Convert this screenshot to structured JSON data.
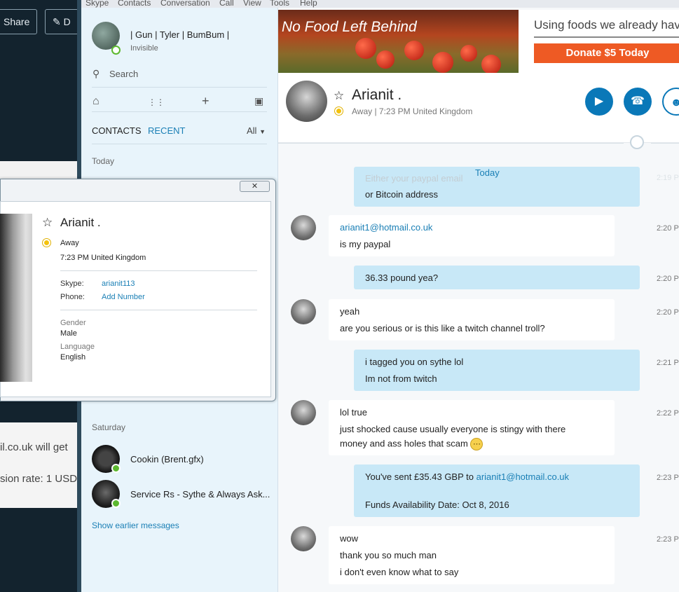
{
  "background_window": {
    "share_label": "Share",
    "edit_label": "D",
    "text_line1": "il.co.uk will get",
    "text_line2": "sion rate: 1 USD"
  },
  "menu": [
    "Skype",
    "Contacts",
    "Conversation",
    "Call",
    "View",
    "Tools",
    "Help"
  ],
  "me": {
    "name": "| Gun | Tyler | BumBum |",
    "status": "Invisible"
  },
  "search": {
    "placeholder": "Search"
  },
  "tabs": {
    "contacts": "CONTACTS",
    "recent": "RECENT",
    "filter": "All"
  },
  "sections": {
    "today": "Today",
    "saturday": "Saturday"
  },
  "recent_contacts": [
    {
      "name": "Cookin (Brent.gfx)"
    },
    {
      "name": "Service Rs - Sythe & Always Ask..."
    }
  ],
  "show_earlier": "Show earlier messages",
  "ad": {
    "title": "No Food Left Behind",
    "tagline": "Using foods we already hav",
    "button": "Donate $5 Today"
  },
  "chat_header": {
    "name": "Arianit .",
    "status": "Away | 7:23 PM United Kingdom"
  },
  "today_separator": "Today",
  "messages": [
    {
      "dir": "out",
      "lines": [
        "Either your paypal email",
        "or Bitcoin address"
      ],
      "time": "2:19 P"
    },
    {
      "dir": "in",
      "lines": [
        "arianit1@hotmail.co.uk",
        "is my paypal"
      ],
      "time": "2:20 P"
    },
    {
      "dir": "out",
      "lines": [
        "36.33 pound yea?"
      ],
      "time": "2:20 P"
    },
    {
      "dir": "in",
      "lines": [
        "yeah",
        "are you serious or is this like a twitch channel troll?"
      ],
      "time": "2:20 P"
    },
    {
      "dir": "out",
      "lines": [
        "i tagged you on sythe lol",
        "Im not from twitch"
      ],
      "time": "2:21 P"
    },
    {
      "dir": "in",
      "lines": [
        "lol true",
        "just shocked cause usually everyone is stingy with there",
        "money and ass holes that scam"
      ],
      "time": "2:22 P"
    },
    {
      "dir": "out",
      "lines": [
        "You've sent £35.43 GBP to ",
        "arianit1@hotmail.co.uk",
        "Funds Availability Date: Oct 8, 2016"
      ],
      "time": "2:23 P"
    },
    {
      "dir": "in",
      "lines": [
        "wow",
        "thank you so much man",
        "i don't even know what to say"
      ],
      "time": "2:23 P"
    }
  ],
  "profile": {
    "name": "Arianit .",
    "status": "Away",
    "local_time": "7:23 PM United Kingdom",
    "skype_label": "Skype:",
    "skype_value": "arianit113",
    "phone_label": "Phone:",
    "phone_value": "Add Number",
    "gender_label": "Gender",
    "gender_value": "Male",
    "language_label": "Language",
    "language_value": "English"
  },
  "colors": {
    "accent": "#0a78b8",
    "link": "#1a7fb5",
    "outgoing_bubble": "#c8e8f7",
    "sidebar_bg": "#e8f4fb",
    "away": "#f4c20d",
    "online": "#5cb82f",
    "ad_button": "#ee5a24"
  },
  "icons": [
    "home-icon",
    "dialpad-icon",
    "add-icon",
    "bot-icon",
    "search-icon",
    "star-icon",
    "video-call-icon",
    "phone-call-icon",
    "add-person-icon",
    "globe-icon",
    "close-icon",
    "chevron-down-icon",
    "emoji-icon"
  ]
}
